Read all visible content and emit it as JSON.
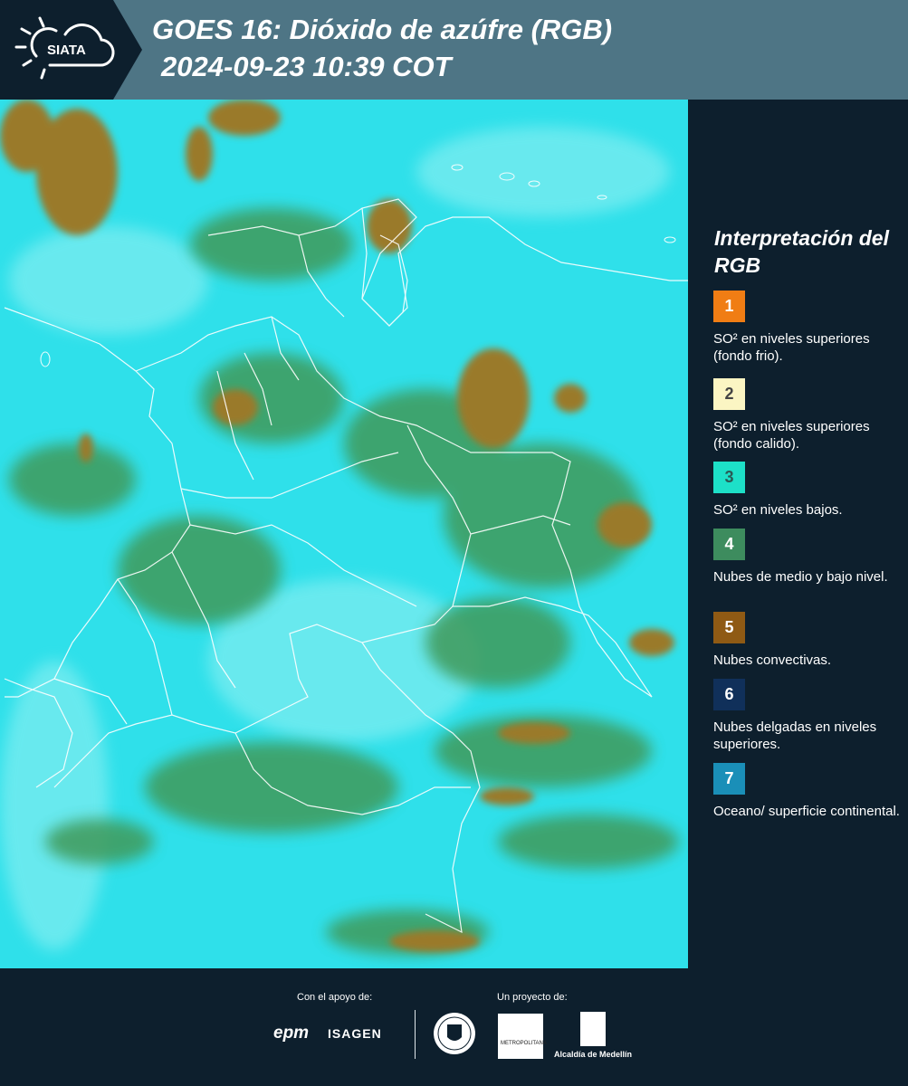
{
  "header": {
    "logo_text": "SIATA",
    "title": "GOES 16: Dióxido de azúfre (RGB)",
    "subtitle": "2024-09-23 10:39 COT"
  },
  "map": {
    "description_colors": {
      "background": "#2fe0ea",
      "cloud_low": "#3f9a5a",
      "cloud_convective": "#9a7a2a",
      "haze": "#8ff0f2",
      "borders": "#ffffff"
    }
  },
  "legend": {
    "title": "Interpretación del RGB",
    "items": [
      {
        "number": "1",
        "color": "#f07d14",
        "label": "SO² en niveles superiores (fondo frio)."
      },
      {
        "number": "2",
        "color": "#fbf5c3",
        "label": "SO² en niveles superiores (fondo calido)."
      },
      {
        "number": "3",
        "color": "#1de0c8",
        "label": "SO² en niveles bajos."
      },
      {
        "number": "4",
        "color": "#3d8c5e",
        "label": "Nubes de medio y bajo nivel."
      },
      {
        "number": "5",
        "color": "#8f5a14",
        "label": "Nubes convectivas."
      },
      {
        "number": "6",
        "color": "#10305a",
        "label": "Nubes delgadas en niveles superiores."
      },
      {
        "number": "7",
        "color": "#1a8fb8",
        "label": "Oceano/ superficie continental."
      }
    ]
  },
  "footer": {
    "support_label": "Con el apoyo de:",
    "project_label": "Un proyecto de:",
    "sponsor_1": "epm",
    "sponsor_2": "ISAGEN",
    "partner_1": "METROPOLITANA",
    "partner_2": "Alcaldía de Medellín"
  }
}
